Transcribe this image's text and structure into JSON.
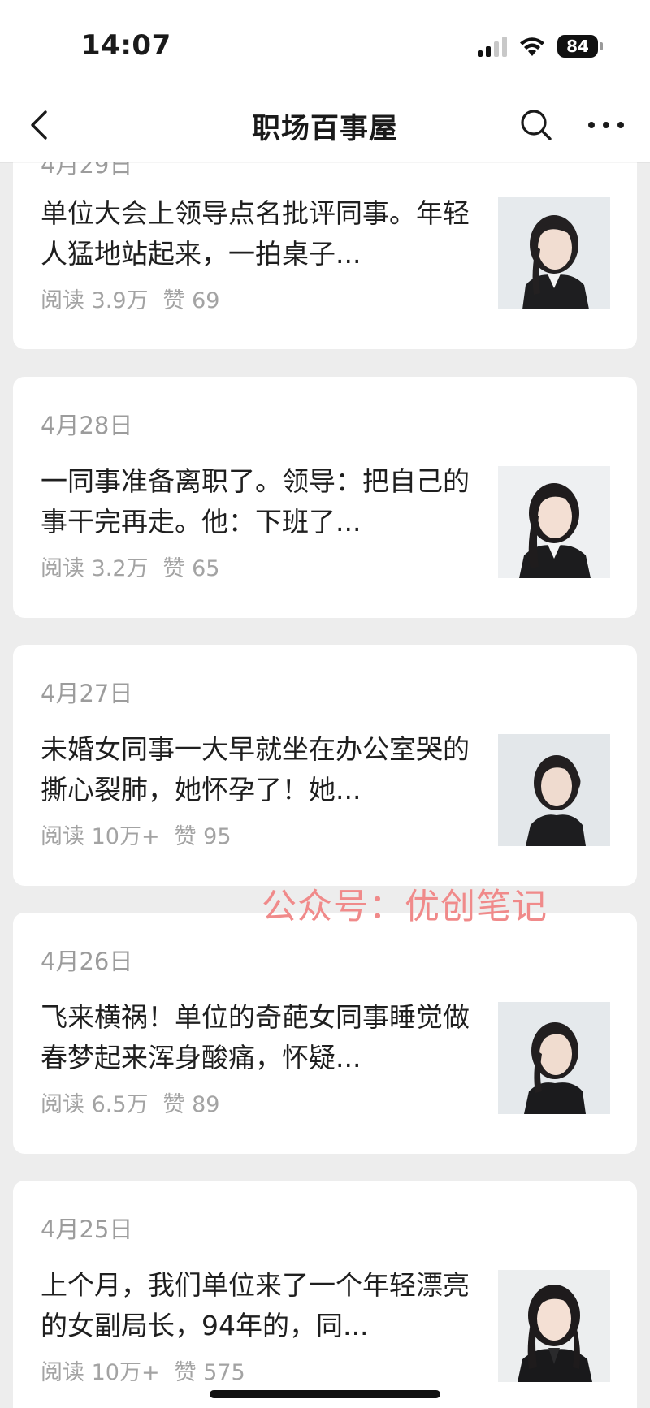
{
  "status_bar": {
    "time": "14:07",
    "battery": "84"
  },
  "nav": {
    "title": "职场百事屋"
  },
  "articles": [
    {
      "date": "4月29日",
      "title": "单位大会上领导点名批评同事。年轻人猛地站起来，一拍桌子...",
      "reads": "阅读 3.9万",
      "likes": "赞 69"
    },
    {
      "date": "4月28日",
      "title": "一同事准备离职了。领导：把自己的事干完再走。他：下班了...",
      "reads": "阅读 3.2万",
      "likes": "赞 65"
    },
    {
      "date": "4月27日",
      "title": "未婚女同事一大早就坐在办公室哭的撕心裂肺，她怀孕了！她...",
      "reads": "阅读 10万+",
      "likes": "赞 95"
    },
    {
      "date": "4月26日",
      "title": "飞来横祸！单位的奇葩女同事睡觉做春梦起来浑身酸痛，怀疑...",
      "reads": "阅读 6.5万",
      "likes": "赞 89"
    },
    {
      "date": "4月25日",
      "title": "上个月，我们单位来了一个年轻漂亮的女副局长，94年的，同...",
      "reads": "阅读 10万+",
      "likes": "赞 575"
    }
  ],
  "watermark": "公众号：优创笔记",
  "colors": {
    "background": "#ededed",
    "card": "#ffffff",
    "meta_text": "#a3a3a3",
    "watermark": "#f08a8a"
  }
}
